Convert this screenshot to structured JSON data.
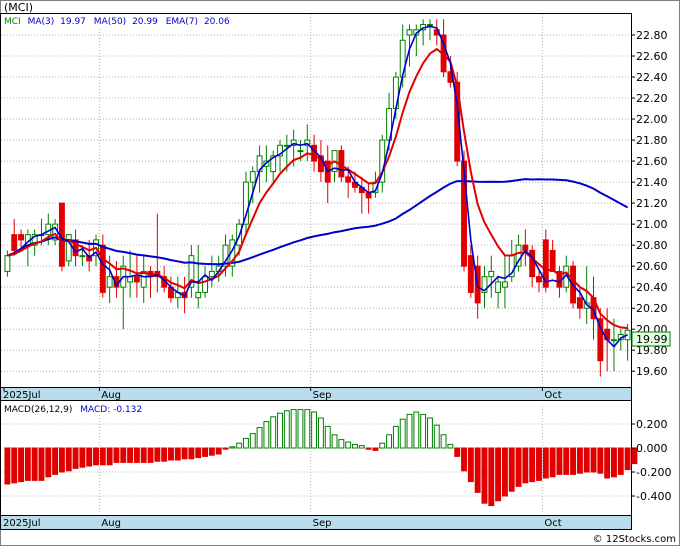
{
  "symbol": "(MCI)",
  "legend_main": {
    "ticker": "MCI",
    "ma3_label": "MA(3)",
    "ma3_value": "19.97",
    "ma50_label": "MA(50)",
    "ma50_value": "20.99",
    "ema7_label": "EMA(7)",
    "ema7_value": "20.06"
  },
  "legend_macd": {
    "label": "MACD(26,12,9)",
    "value_label": "MACD:",
    "value": "-0.132"
  },
  "last_price_label": "19.99",
  "copyright": "© 12Stocks.com",
  "colors": {
    "up": "#008000",
    "down": "#e00000",
    "ma_fast": "#0000cc",
    "ma_slow": "#e00000",
    "axis_bar": "#b8dcea"
  },
  "chart_data": [
    {
      "type": "candlestick",
      "y_ticks": [
        19.6,
        19.8,
        20.0,
        20.2,
        20.4,
        20.6,
        20.8,
        21.0,
        21.2,
        21.4,
        21.6,
        21.8,
        22.0,
        22.2,
        22.4,
        22.6,
        22.8
      ],
      "y_tick_labels": [
        "19.60",
        "19.80",
        "20.00",
        "20.20",
        "20.40",
        "20.60",
        "20.80",
        "21.00",
        "21.20",
        "21.40",
        "21.60",
        "21.80",
        "22.00",
        "22.20",
        "22.40",
        "22.60",
        "22.80"
      ],
      "ylim": [
        19.45,
        23.0
      ],
      "x_labels": [
        {
          "label": "2025Jul",
          "index": 0
        },
        {
          "label": "Aug",
          "index": 14
        },
        {
          "label": "Sep",
          "index": 45
        },
        {
          "label": "Oct",
          "index": 79
        }
      ],
      "candles": [
        [
          20.55,
          20.75,
          20.5,
          20.7
        ],
        [
          20.9,
          21.05,
          20.7,
          20.75
        ],
        [
          20.9,
          20.95,
          20.75,
          20.85
        ],
        [
          20.8,
          20.95,
          20.6,
          20.9
        ],
        [
          20.8,
          20.95,
          20.7,
          20.9
        ],
        [
          20.9,
          21.05,
          20.8,
          20.9
        ],
        [
          20.9,
          21.1,
          20.8,
          21.0
        ],
        [
          20.85,
          21.05,
          20.8,
          21.0
        ],
        [
          21.2,
          21.2,
          20.55,
          20.6
        ],
        [
          20.65,
          20.9,
          20.6,
          20.9
        ],
        [
          20.85,
          20.95,
          20.6,
          20.7
        ],
        [
          20.7,
          20.8,
          20.6,
          20.7
        ],
        [
          20.7,
          20.85,
          20.55,
          20.65
        ],
        [
          20.7,
          20.9,
          20.6,
          20.85
        ],
        [
          20.8,
          20.9,
          20.3,
          20.35
        ],
        [
          20.4,
          20.7,
          20.25,
          20.5
        ],
        [
          20.5,
          20.65,
          20.3,
          20.4
        ],
        [
          20.4,
          20.7,
          20.0,
          20.6
        ],
        [
          20.45,
          20.75,
          20.3,
          20.5
        ],
        [
          20.5,
          20.7,
          20.3,
          20.45
        ],
        [
          20.4,
          20.7,
          20.25,
          20.55
        ],
        [
          20.55,
          20.6,
          20.3,
          20.5
        ],
        [
          20.55,
          21.1,
          20.35,
          20.5
        ],
        [
          20.5,
          20.6,
          20.35,
          20.4
        ],
        [
          20.4,
          20.5,
          20.25,
          20.3
        ],
        [
          20.3,
          20.5,
          20.2,
          20.35
        ],
        [
          20.35,
          20.5,
          20.15,
          20.3
        ],
        [
          20.4,
          20.8,
          20.3,
          20.7
        ],
        [
          20.3,
          20.8,
          20.2,
          20.35
        ],
        [
          20.35,
          20.6,
          20.3,
          20.5
        ],
        [
          20.5,
          20.7,
          20.4,
          20.55
        ],
        [
          20.55,
          20.7,
          20.45,
          20.6
        ],
        [
          20.6,
          20.9,
          20.5,
          20.8
        ],
        [
          20.6,
          20.9,
          20.5,
          20.85
        ],
        [
          20.8,
          21.05,
          20.7,
          21.0
        ],
        [
          21.0,
          21.5,
          20.9,
          21.4
        ],
        [
          21.4,
          21.55,
          21.2,
          21.5
        ],
        [
          21.5,
          21.75,
          21.3,
          21.65
        ],
        [
          21.55,
          21.75,
          21.4,
          21.6
        ],
        [
          21.5,
          21.7,
          21.4,
          21.65
        ],
        [
          21.65,
          21.8,
          21.5,
          21.75
        ],
        [
          21.75,
          21.85,
          21.5,
          21.75
        ],
        [
          21.75,
          21.9,
          21.55,
          21.8
        ],
        [
          21.7,
          21.8,
          21.6,
          21.7
        ],
        [
          21.75,
          21.95,
          21.6,
          21.8
        ],
        [
          21.75,
          21.85,
          21.5,
          21.6
        ],
        [
          21.65,
          21.8,
          21.4,
          21.5
        ],
        [
          21.6,
          21.75,
          21.2,
          21.4
        ],
        [
          21.5,
          21.7,
          21.4,
          21.7
        ],
        [
          21.7,
          21.75,
          21.4,
          21.45
        ],
        [
          21.45,
          21.55,
          21.25,
          21.4
        ],
        [
          21.4,
          21.5,
          21.3,
          21.35
        ],
        [
          21.35,
          21.45,
          21.1,
          21.3
        ],
        [
          21.3,
          21.4,
          21.1,
          21.25
        ],
        [
          21.3,
          21.5,
          21.25,
          21.4
        ],
        [
          21.4,
          21.85,
          21.3,
          21.8
        ],
        [
          21.8,
          22.25,
          21.7,
          22.1
        ],
        [
          22.1,
          22.45,
          22.0,
          22.4
        ],
        [
          22.4,
          22.9,
          22.3,
          22.75
        ],
        [
          22.8,
          22.9,
          22.5,
          22.85
        ],
        [
          22.8,
          22.9,
          22.6,
          22.85
        ],
        [
          22.85,
          22.95,
          22.7,
          22.9
        ],
        [
          22.9,
          22.95,
          22.75,
          22.9
        ],
        [
          22.85,
          22.95,
          22.7,
          22.8
        ],
        [
          22.8,
          22.95,
          22.4,
          22.45
        ],
        [
          22.45,
          22.6,
          22.3,
          22.35
        ],
        [
          22.35,
          22.45,
          21.55,
          21.6
        ],
        [
          21.6,
          21.7,
          20.55,
          20.6
        ],
        [
          20.7,
          20.8,
          20.3,
          20.35
        ],
        [
          20.6,
          20.7,
          20.1,
          20.25
        ],
        [
          20.35,
          20.6,
          20.2,
          20.5
        ],
        [
          20.5,
          20.7,
          20.3,
          20.55
        ],
        [
          20.35,
          20.5,
          20.2,
          20.45
        ],
        [
          20.4,
          20.7,
          20.2,
          20.45
        ],
        [
          20.5,
          20.85,
          20.45,
          20.7
        ],
        [
          20.6,
          20.9,
          20.55,
          20.8
        ],
        [
          20.8,
          20.95,
          20.6,
          20.75
        ],
        [
          20.75,
          20.8,
          20.4,
          20.5
        ],
        [
          20.5,
          20.55,
          20.35,
          20.45
        ],
        [
          20.85,
          20.95,
          20.35,
          20.4
        ],
        [
          20.75,
          20.85,
          20.55,
          20.55
        ],
        [
          20.55,
          20.6,
          20.3,
          20.4
        ],
        [
          20.4,
          20.7,
          20.35,
          20.6
        ],
        [
          20.6,
          20.65,
          20.2,
          20.25
        ],
        [
          20.3,
          20.4,
          20.1,
          20.2
        ],
        [
          20.2,
          20.6,
          20.05,
          20.25
        ],
        [
          20.3,
          20.5,
          19.9,
          20.1
        ],
        [
          20.1,
          20.2,
          19.55,
          19.7
        ],
        [
          20.0,
          20.2,
          19.6,
          19.9
        ],
        [
          19.9,
          20.1,
          19.6,
          19.9
        ],
        [
          19.9,
          20.0,
          19.8,
          19.95
        ],
        [
          19.9,
          20.05,
          19.7,
          19.99
        ]
      ],
      "series": [
        {
          "name": "MA(3)",
          "color": "#0000cc"
        },
        {
          "name": "MA(50)",
          "color": "#0000cc"
        },
        {
          "name": "EMA(7)",
          "color": "#e00000"
        }
      ]
    },
    {
      "type": "bar",
      "name": "MACD(26,12,9)",
      "y_ticks": [
        0.2,
        0.0,
        -0.2,
        -0.4
      ],
      "y_tick_labels": [
        "0.200",
        "0.000",
        "-0.200",
        "-0.400"
      ],
      "ylim": [
        -0.55,
        0.35
      ],
      "x_labels": [
        {
          "label": "2025Jul",
          "index": 0
        },
        {
          "label": "Aug",
          "index": 14
        },
        {
          "label": "Sep",
          "index": 45
        },
        {
          "label": "Oct",
          "index": 79
        }
      ],
      "values": [
        -0.3,
        -0.29,
        -0.28,
        -0.27,
        -0.27,
        -0.27,
        -0.24,
        -0.22,
        -0.2,
        -0.19,
        -0.17,
        -0.16,
        -0.15,
        -0.14,
        -0.14,
        -0.14,
        -0.12,
        -0.12,
        -0.12,
        -0.12,
        -0.12,
        -0.12,
        -0.11,
        -0.11,
        -0.1,
        -0.1,
        -0.09,
        -0.09,
        -0.08,
        -0.07,
        -0.06,
        -0.05,
        -0.01,
        0.01,
        0.04,
        0.08,
        0.12,
        0.17,
        0.22,
        0.26,
        0.29,
        0.31,
        0.32,
        0.32,
        0.32,
        0.3,
        0.25,
        0.18,
        0.11,
        0.07,
        0.05,
        0.03,
        0.02,
        -0.01,
        -0.02,
        0.04,
        0.11,
        0.18,
        0.24,
        0.28,
        0.3,
        0.28,
        0.25,
        0.19,
        0.11,
        0.03,
        -0.07,
        -0.19,
        -0.28,
        -0.37,
        -0.46,
        -0.48,
        -0.44,
        -0.4,
        -0.36,
        -0.32,
        -0.29,
        -0.28,
        -0.27,
        -0.25,
        -0.24,
        -0.22,
        -0.22,
        -0.22,
        -0.21,
        -0.2,
        -0.2,
        -0.21,
        -0.25,
        -0.24,
        -0.22,
        -0.18,
        -0.13
      ]
    }
  ]
}
